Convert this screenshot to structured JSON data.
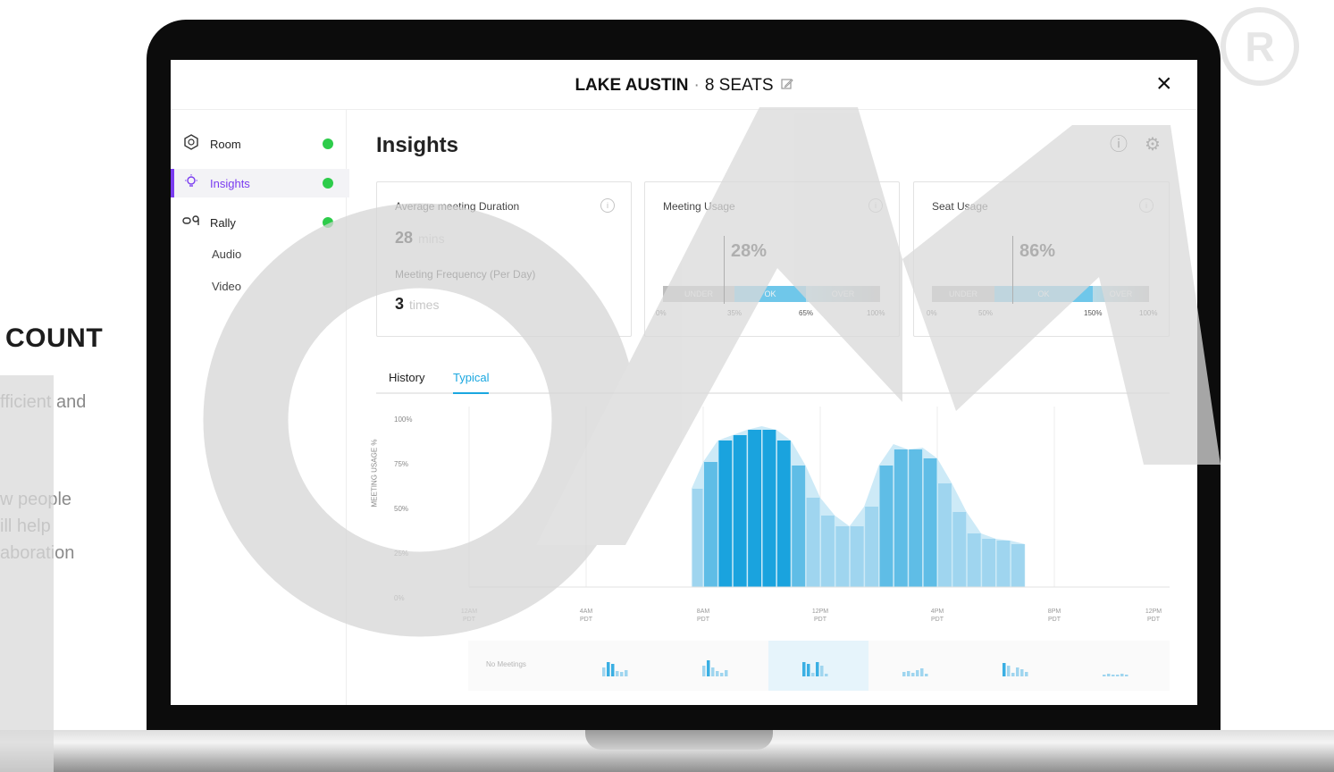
{
  "side_text": {
    "title": "COUNT",
    "para1": "fficient and",
    "para2": [
      "w people",
      "ill help",
      "aboration"
    ]
  },
  "header": {
    "room_name": "LAKE AUSTIN",
    "separator": "·",
    "seats": "8 SEATS",
    "edit_icon": "edit-icon",
    "close_icon": "×"
  },
  "sidebar": {
    "items": [
      {
        "label": "Room",
        "icon": "room-icon",
        "glyph": "⌬",
        "status": "online"
      },
      {
        "label": "Insights",
        "icon": "lightbulb-icon",
        "glyph": "💡",
        "status": "online"
      },
      {
        "label": "Rally",
        "icon": "rally-icon",
        "glyph": "⧉",
        "status": "online"
      }
    ],
    "sub_items": [
      "Audio",
      "Video"
    ]
  },
  "main": {
    "title": "Insights",
    "info_icon": "ⓘ",
    "settings_icon": "⚙"
  },
  "cards": {
    "duration": {
      "label": "Average meeting Duration",
      "value": "28",
      "unit": "mins",
      "freq_label": "Meeting Frequency (Per Day)",
      "freq_value": "3",
      "freq_unit": "times"
    },
    "meeting_usage": {
      "label": "Meeting Usage",
      "value": "28%",
      "value_fraction": 0.28,
      "segments": [
        "UNDER",
        "OK",
        "OVER"
      ],
      "ticks": [
        "0%",
        "35%",
        "65%",
        "100%"
      ]
    },
    "seat_usage": {
      "label": "Seat Usage",
      "value": "86%",
      "value_fraction": 0.86,
      "segments": [
        "UNDER",
        "OK",
        "OVER"
      ],
      "ticks": [
        "0%",
        "50%",
        "150%",
        "100%"
      ]
    }
  },
  "tabs": [
    "History",
    "Typical"
  ],
  "chart_data": {
    "type": "area",
    "ylabel": "MEETING USAGE %",
    "yticks": [
      "100%",
      "75%",
      "50%",
      "25%",
      "0%"
    ],
    "xticks": [
      {
        "time": "12AM",
        "tz": "PDT"
      },
      {
        "time": "4AM",
        "tz": "PDT"
      },
      {
        "time": "8AM",
        "tz": "PDT"
      },
      {
        "time": "12PM",
        "tz": "PDT"
      },
      {
        "time": "4PM",
        "tz": "PDT"
      },
      {
        "time": "8PM",
        "tz": "PDT"
      },
      {
        "time": "12PM",
        "tz": "PDT"
      }
    ],
    "x_hours": [
      7.6,
      8.0,
      8.5,
      9.0,
      9.5,
      10.0,
      10.5,
      11.0,
      11.5,
      12.0,
      12.5,
      13.0,
      13.5,
      14.0,
      14.5,
      15.0,
      15.5,
      16.0,
      16.5,
      17.0,
      17.5,
      18.0,
      18.5,
      19.0
    ],
    "values": [
      55,
      70,
      82,
      85,
      88,
      90,
      88,
      82,
      68,
      50,
      40,
      34,
      45,
      68,
      80,
      77,
      78,
      72,
      58,
      42,
      30,
      27,
      26,
      24
    ],
    "ylim": [
      0,
      100
    ]
  },
  "day_strip": {
    "no_meetings_label": "No Meetings",
    "selected_index": 3
  }
}
